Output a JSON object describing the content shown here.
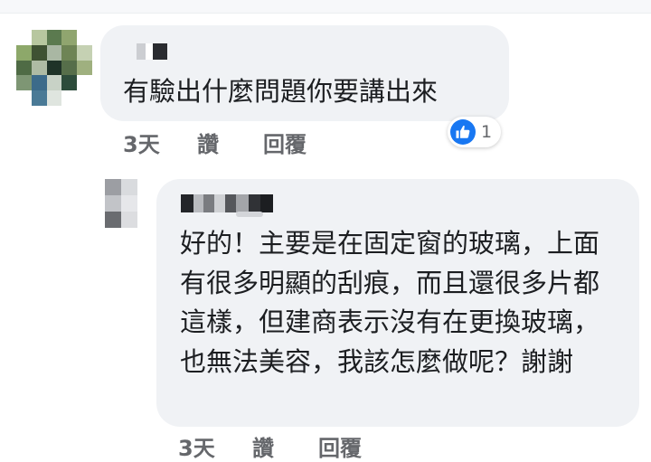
{
  "comments": [
    {
      "text": "有驗出什麼問題你要講出來",
      "time": "3天",
      "like_label": "讚",
      "reply_label": "回覆",
      "reaction": {
        "icon": "thumbs-up-icon",
        "count": "1",
        "color": "#1877f2"
      }
    },
    {
      "text": "好的！主要是在固定窗的玻璃，上面有很多明顯的刮痕，而且還很多片都這樣，但建商表示沒有在更換玻璃，也無法美容，我該怎麼做呢？謝謝",
      "time": "3天",
      "like_label": "讚",
      "reply_label": "回覆"
    }
  ],
  "colors": {
    "bubble_bg": "#f0f2f5",
    "text": "#1c1e21",
    "meta_text": "#65676b",
    "like_blue": "#1877f2"
  }
}
